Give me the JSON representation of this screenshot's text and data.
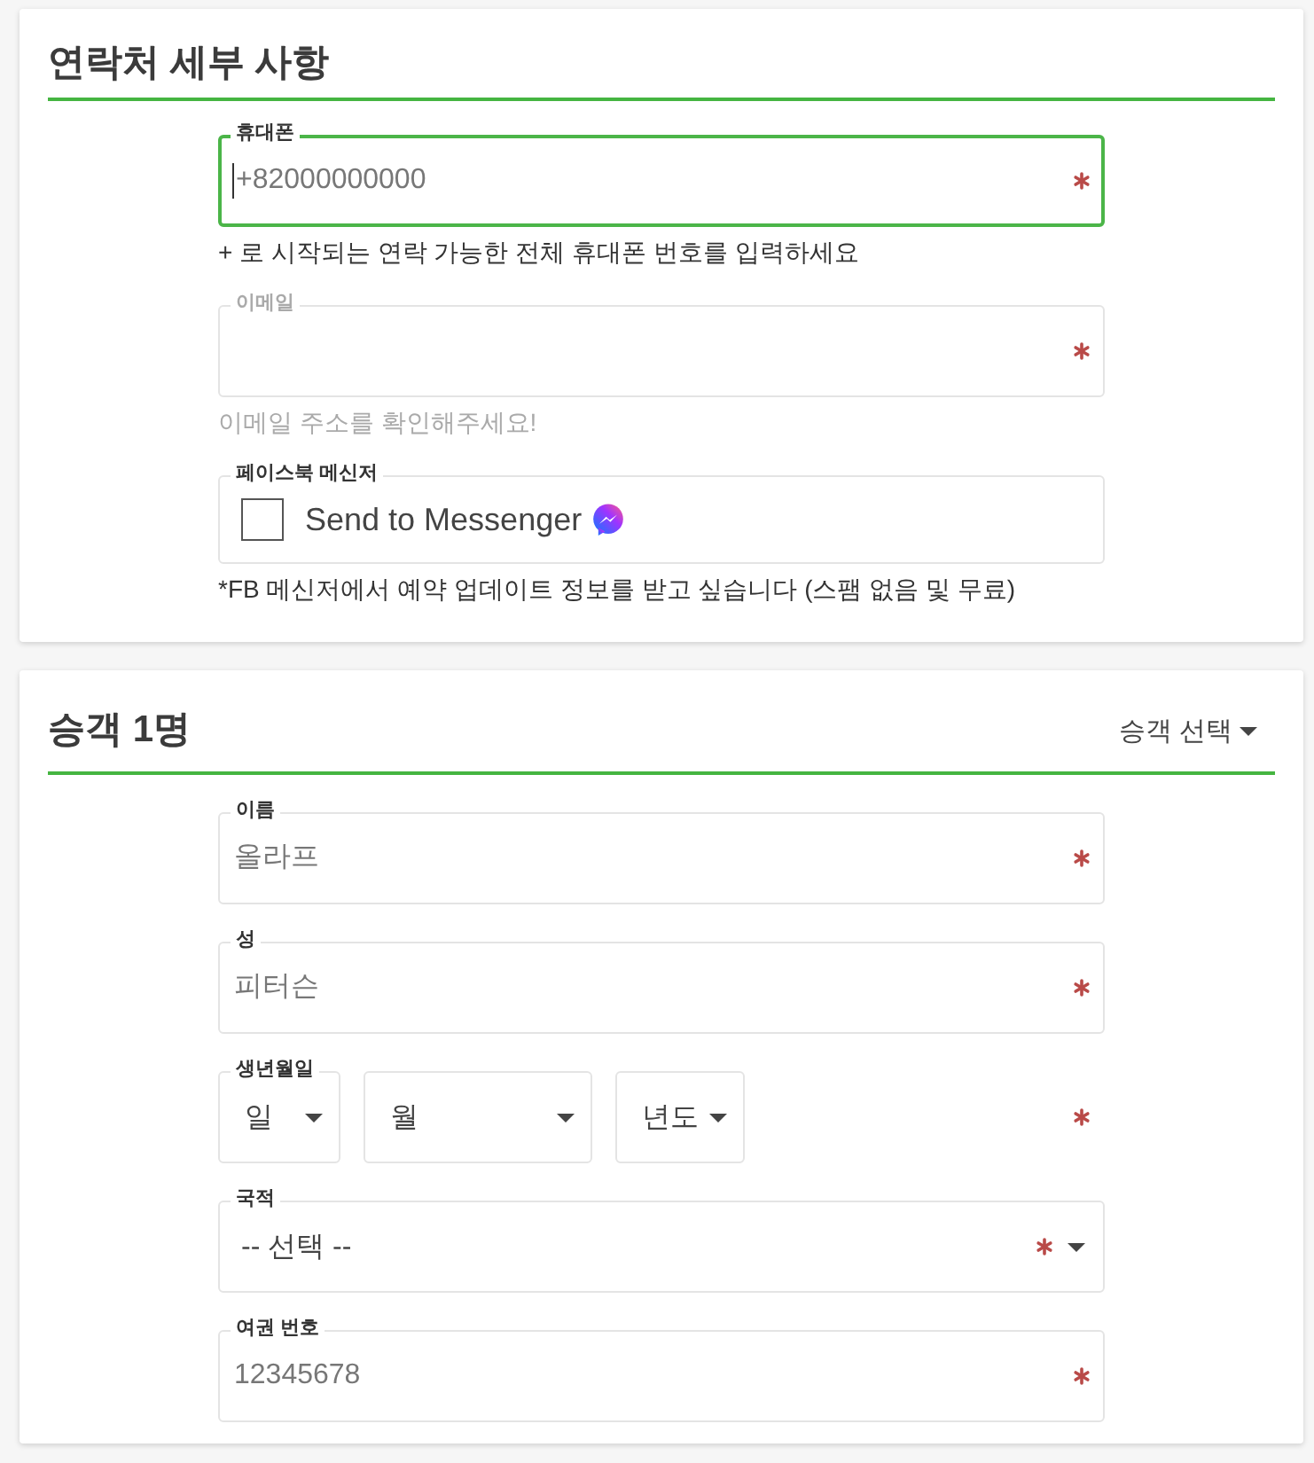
{
  "sections": [
    {
      "title": "연락처 세부 사항",
      "fields": [
        {
          "kind": "text",
          "label": "휴대폰",
          "placeholder": "+82000000000",
          "required": true,
          "focused": true,
          "muted": false,
          "hint": "+ 로 시작되는 연락 가능한 전체 휴대폰 번호를 입력하세요"
        },
        {
          "kind": "text",
          "label": "이메일",
          "required": true,
          "focused": false,
          "muted": true,
          "hint": "이메일 주소를 확인해주세요!"
        },
        {
          "kind": "checkbox",
          "label": "페이스북 메신저",
          "option": "Send to Messenger",
          "checked": false,
          "required": false,
          "focused": false,
          "muted": false,
          "hint": "*FB 메신저에서 예약 업데이트 정보를 받고 싶습니다 (스팸 없음 및 무료)"
        }
      ]
    },
    {
      "title": "승객 1명",
      "menu": "승객 선택",
      "fields": [
        {
          "kind": "text",
          "label": "이름",
          "placeholder": "올라프",
          "required": true,
          "focused": false,
          "muted": false
        },
        {
          "kind": "text",
          "label": "성",
          "placeholder": "피터슨",
          "required": true,
          "focused": false,
          "muted": false
        },
        {
          "kind": "date",
          "label": "생년월일",
          "required": true,
          "focused": false,
          "muted": false,
          "parts": [
            {
              "text": "일"
            },
            {
              "text": "월"
            },
            {
              "text": "년도"
            }
          ]
        },
        {
          "kind": "select",
          "label": "국적",
          "value": "-- 선택 --",
          "required": true,
          "focused": false,
          "muted": false
        },
        {
          "kind": "text",
          "label": "여권 번호",
          "placeholder": "12345678",
          "required": true,
          "focused": false,
          "muted": false
        }
      ]
    }
  ]
}
